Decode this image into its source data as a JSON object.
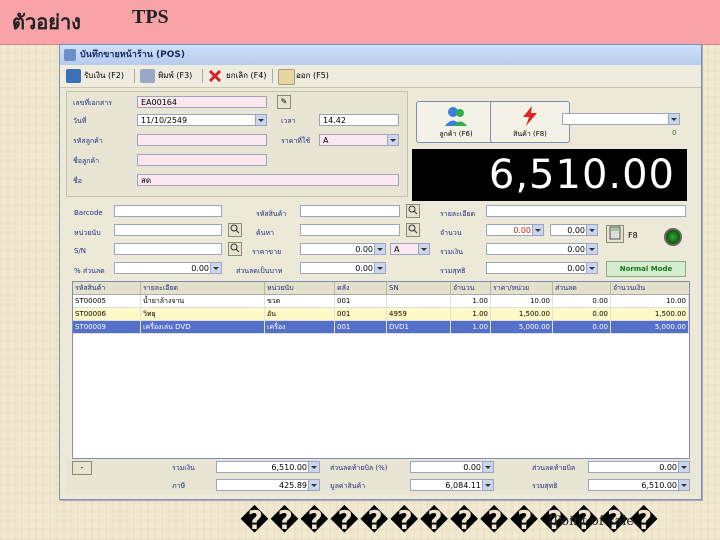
{
  "slide": {
    "title": "ตัวอย่าง",
    "subtitle": "TPS",
    "caption": "��������������",
    "caption_sub": "(Point of sale"
  },
  "window": {
    "title": "บันทึกขายหน้าร้าน (POS)"
  },
  "toolbar": [
    {
      "label": "รับเงิน (F2)",
      "icon": "save-icon"
    },
    {
      "label": "พิมพ์ (F3)",
      "icon": "print-icon"
    },
    {
      "label": "ยกเลิก (F4)",
      "icon": "close-icon"
    },
    {
      "label": "ออก (F5)",
      "icon": "exit-icon"
    }
  ],
  "header": {
    "doc_no_label": "เลขที่เอกสาร",
    "doc_no": "EA00164",
    "date_label": "วันที่",
    "date": "11/10/2549",
    "time_label": "เวลา",
    "time": "14.42",
    "customer_code_label": "รหัสลูกค้า",
    "price_level_label": "ราคาที่ใช้",
    "price_level": "A",
    "customer_name_label": "ชื่อลูกค้า",
    "name_label": "ชื่อ",
    "name": "สด"
  },
  "buttons": {
    "customer": "ลูกค้า (F6)",
    "product": "สินค้า (F8)",
    "f8": "F8",
    "mode": "Normal Mode"
  },
  "top_right": {
    "value": "0"
  },
  "total_display": "6,510.00",
  "entry": {
    "barcode_label": "Barcode",
    "unit_label": "หน่วยนับ",
    "sn_label": "S/N",
    "discount_pct_label": "% ส่วนลด",
    "discount_pct": "0.00",
    "product_code_label": "รหัสสินค้า",
    "search_label": "ค้นหา",
    "price_label": "ราคาขาย",
    "price": "0.00",
    "price_level": "A",
    "discount_baht_label": "ส่วนลดเป็นบาท",
    "discount_baht": "0.00",
    "detail_label": "รายละเอียด",
    "qty_label": "จำนวน",
    "qty": "0.00",
    "qty2": "0.00",
    "amount_label": "รวมเงิน",
    "amount": "0.00",
    "net_label": "รวมสุทธิ",
    "net": "0.00"
  },
  "grid": {
    "columns": [
      "รหัสสินค้า",
      "รายละเอียด",
      "หน่วยนับ",
      "คลัง",
      "SN",
      "จำนวน",
      "ราคา/หน่วย",
      "ส่วนลด",
      "จำนวนเงิน"
    ],
    "rows": [
      [
        "ST00005",
        "น้ำยาล้างจาน",
        "ขวด",
        "001",
        "",
        "1.00",
        "10.00",
        "0.00",
        "10.00"
      ],
      [
        "ST00006",
        "วิทยุ",
        "อัน",
        "001",
        "4959",
        "1.00",
        "1,500.00",
        "0.00",
        "1,500.00"
      ],
      [
        "ST00009",
        "เครื่องเล่น DVD",
        "เครื่อง",
        "001",
        "DVD1",
        "1.00",
        "5,000.00",
        "0.00",
        "5,000.00"
      ]
    ]
  },
  "footer": {
    "sum_label": "รวมเงิน",
    "sum": "6,510.00",
    "vat_label": "ภาษี",
    "vat": "425.89",
    "discount_label": "ส่วนลดท้ายบิล (%)",
    "discount": "0.00",
    "before_vat_label": "มูลค่าสินค้า",
    "before_vat": "6,084.11",
    "bill_discount_label": "ส่วนลดท้ายบิล",
    "bill_discount": "0.00",
    "net_label": "รวมสุทธิ",
    "net": "6,510.00"
  }
}
